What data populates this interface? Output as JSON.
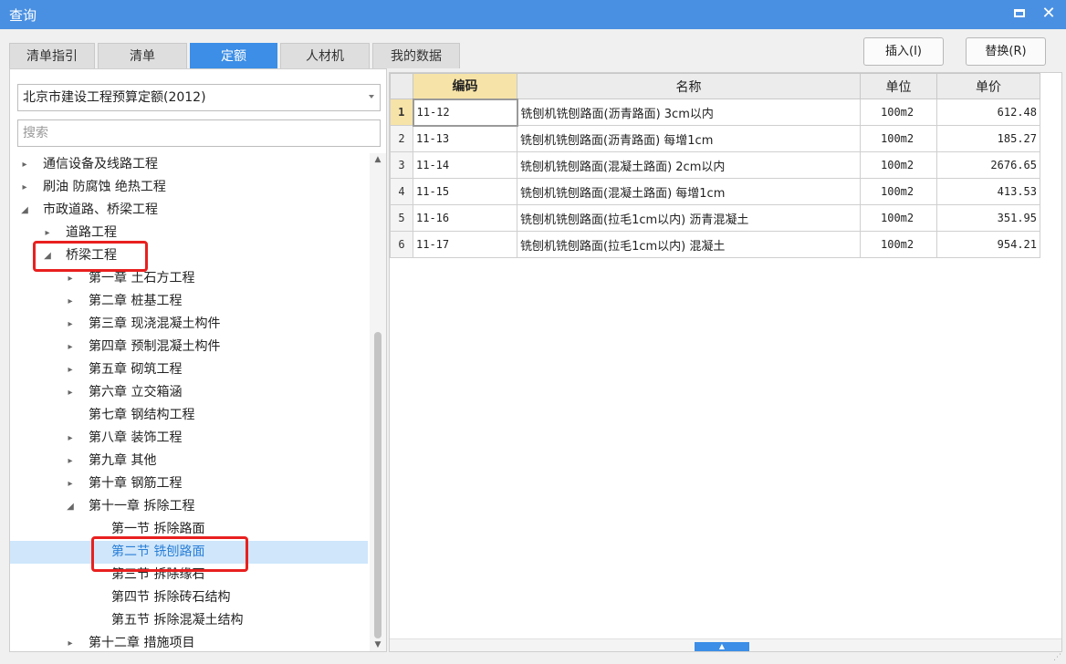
{
  "window": {
    "title": "查询",
    "min_icon": "minimize-icon",
    "close_label": "✕",
    "accent_color": "#4a90e2"
  },
  "tabs": [
    {
      "label": "清单指引",
      "active": false
    },
    {
      "label": "清单",
      "active": false
    },
    {
      "label": "定额",
      "active": true
    },
    {
      "label": "人材机",
      "active": false
    },
    {
      "label": "我的数据",
      "active": false
    }
  ],
  "buttons": {
    "insert": "插入(I)",
    "replace": "替换(R)"
  },
  "left": {
    "dropdown_value": "北京市建设工程预算定额(2012)",
    "search_placeholder": "搜索",
    "tree": [
      {
        "label": "通信设备及线路工程",
        "level": 0,
        "expanded": false,
        "has_children": true
      },
      {
        "label": "刷油 防腐蚀 绝热工程",
        "level": 0,
        "expanded": false,
        "has_children": true
      },
      {
        "label": "市政道路、桥梁工程",
        "level": 0,
        "expanded": true,
        "has_children": true
      },
      {
        "label": "道路工程",
        "level": 1,
        "expanded": false,
        "has_children": true
      },
      {
        "label": "桥梁工程",
        "level": 1,
        "expanded": true,
        "has_children": true,
        "highlighted": true
      },
      {
        "label": "第一章 土石方工程",
        "level": 2,
        "expanded": false,
        "has_children": true
      },
      {
        "label": "第二章 桩基工程",
        "level": 2,
        "expanded": false,
        "has_children": true
      },
      {
        "label": "第三章 现浇混凝土构件",
        "level": 2,
        "expanded": false,
        "has_children": true
      },
      {
        "label": "第四章 预制混凝土构件",
        "level": 2,
        "expanded": false,
        "has_children": true
      },
      {
        "label": "第五章 砌筑工程",
        "level": 2,
        "expanded": false,
        "has_children": true
      },
      {
        "label": "第六章 立交箱涵",
        "level": 2,
        "expanded": false,
        "has_children": true
      },
      {
        "label": "第七章 钢结构工程",
        "level": 2,
        "expanded": false,
        "has_children": false
      },
      {
        "label": "第八章 装饰工程",
        "level": 2,
        "expanded": false,
        "has_children": true
      },
      {
        "label": "第九章 其他",
        "level": 2,
        "expanded": false,
        "has_children": true
      },
      {
        "label": "第十章 钢筋工程",
        "level": 2,
        "expanded": false,
        "has_children": true
      },
      {
        "label": "第十一章 拆除工程",
        "level": 2,
        "expanded": true,
        "has_children": true
      },
      {
        "label": "第一节 拆除路面",
        "level": 3,
        "expanded": false,
        "has_children": false
      },
      {
        "label": "第二节 铣刨路面",
        "level": 3,
        "expanded": false,
        "has_children": false,
        "selected": true,
        "highlighted": true
      },
      {
        "label": "第三节 拆除缘石",
        "level": 3,
        "expanded": false,
        "has_children": false
      },
      {
        "label": "第四节 拆除砖石结构",
        "level": 3,
        "expanded": false,
        "has_children": false
      },
      {
        "label": "第五节 拆除混凝土结构",
        "level": 3,
        "expanded": false,
        "has_children": false
      },
      {
        "label": "第十二章 措施项目",
        "level": 2,
        "expanded": false,
        "has_children": true
      }
    ]
  },
  "grid": {
    "headers": {
      "code": "编码",
      "name": "名称",
      "unit": "单位",
      "price": "单价"
    },
    "rows": [
      {
        "n": "1",
        "code": "11-12",
        "name": "铣刨机铣刨路面(沥青路面) 3cm以内",
        "unit": "100m2",
        "price": "612.48"
      },
      {
        "n": "2",
        "code": "11-13",
        "name": "铣刨机铣刨路面(沥青路面) 每增1cm",
        "unit": "100m2",
        "price": "185.27"
      },
      {
        "n": "3",
        "code": "11-14",
        "name": "铣刨机铣刨路面(混凝土路面) 2cm以内",
        "unit": "100m2",
        "price": "2676.65"
      },
      {
        "n": "4",
        "code": "11-15",
        "name": "铣刨机铣刨路面(混凝土路面) 每增1cm",
        "unit": "100m2",
        "price": "413.53"
      },
      {
        "n": "5",
        "code": "11-16",
        "name": "铣刨机铣刨路面(拉毛1cm以内) 沥青混凝土",
        "unit": "100m2",
        "price": "351.95"
      },
      {
        "n": "6",
        "code": "11-17",
        "name": "铣刨机铣刨路面(拉毛1cm以内) 混凝土",
        "unit": "100m2",
        "price": "954.21"
      }
    ],
    "current_row": 0
  },
  "highlight_color": "#e8201f",
  "selection_color": "#cfe6fb"
}
